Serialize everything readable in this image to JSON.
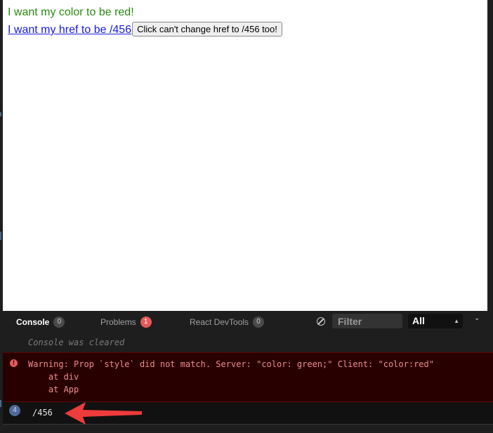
{
  "preview": {
    "colored_text": "I want my color to be red!",
    "link_text": "I want my href to be /456",
    "button_label": "Click can't change href to /456 too!"
  },
  "devtools": {
    "tabs": [
      {
        "label": "Console",
        "count": "0"
      },
      {
        "label": "Problems",
        "count": "1"
      },
      {
        "label": "React DevTools",
        "count": "0"
      }
    ],
    "filter_placeholder": "Filter",
    "level": "All"
  },
  "console": {
    "cleared": "Console was cleared",
    "error": {
      "message": "Warning: Prop `style` did not match. Server: \"color: green;\" Client: \"color:red\"",
      "stack": [
        "    at div",
        "    at App"
      ]
    },
    "log": {
      "repeat": "4",
      "text": "/456"
    }
  },
  "colors": {
    "green_text": "#2a8a12",
    "link": "#1a1ae8",
    "error_bg": "#290000",
    "error_text": "#f08a8a",
    "arrow": "#ee3b3b"
  },
  "icons": [
    "clear-console-icon",
    "updown-icon",
    "chevron-down-icon",
    "error-icon",
    "arrow-annotation"
  ]
}
